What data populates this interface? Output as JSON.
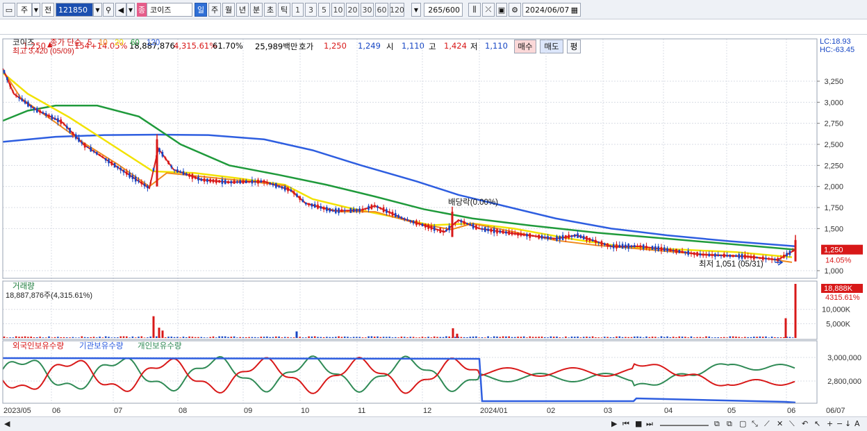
{
  "toolbar": {
    "period_main": "주",
    "prev_label": "전",
    "stock_code": "121850",
    "stock_name": "코이즈",
    "stock_tag": "종",
    "periods": [
      "일",
      "주",
      "월",
      "년",
      "분",
      "초",
      "틱"
    ],
    "active_period": "일",
    "intervals": [
      "1",
      "3",
      "5",
      "10",
      "20",
      "30",
      "60",
      "120"
    ],
    "count": "265",
    "count_max": "/600",
    "date": "2024/06/07"
  },
  "info": {
    "price": "1,250",
    "change": "154",
    "change_pct": "+14.05%",
    "volume": "18,887,876",
    "volume_pct": "4,315.61%",
    "turnover": "61.70%",
    "amount": "25,989백만",
    "quote_label": "호가",
    "ask": "1,250",
    "bid": "1,249",
    "open_label": "시",
    "open": "1,110",
    "high_label": "고",
    "high": "1,424",
    "low_label": "저",
    "low": "1,110",
    "buy": "매수",
    "sell": "매도",
    "avg": "평"
  },
  "price_panel": {
    "name": "코이즈",
    "ma_label": "종가 단순",
    "ma_periods": [
      {
        "label": "5",
        "color": "#d62020"
      },
      {
        "label": "10",
        "color": "#f08a1c"
      },
      {
        "label": "20",
        "color": "#f2e200"
      },
      {
        "label": "60",
        "color": "#1f9a3b"
      },
      {
        "label": "120",
        "color": "#2e5ee0"
      }
    ],
    "high_marker": "최고 3,420 (05/09)",
    "low_marker": "최저 1,051 (05/31)",
    "annotation": "배당락(0.00%)",
    "lc": "LC:18.93",
    "hc": "HC:-63.45",
    "y_ticks": [
      "3,250",
      "3,000",
      "2,750",
      "2,500",
      "2,250",
      "2,000",
      "1,750",
      "1,500",
      "1,000"
    ],
    "current_tag": "1,250",
    "current_pct": "14.05%"
  },
  "volume_panel": {
    "title": "거래량",
    "value": "18,887,876주(4,315.61%)",
    "y_ticks": [
      "10,000K",
      "5,000K"
    ],
    "current_tag": "18,888K",
    "current_pct": "4315.61%"
  },
  "holding_panel": {
    "labels": [
      "외국인보유수량",
      "기관보유수량",
      "개인보유수량"
    ],
    "y_ticks": [
      "3,000,000",
      "2,800,000"
    ]
  },
  "x_axis": [
    "2023/05",
    "06",
    "07",
    "08",
    "09",
    "10",
    "11",
    "12",
    "2024/01",
    "02",
    "03",
    "04",
    "05",
    "06",
    "06/07"
  ],
  "colors": {
    "up": "#d81818",
    "down": "#1646c4",
    "ma5": "#d62020",
    "ma10": "#f08a1c",
    "ma20": "#f2e200",
    "ma60": "#1f9a3b",
    "ma120": "#2e5ee0"
  }
}
